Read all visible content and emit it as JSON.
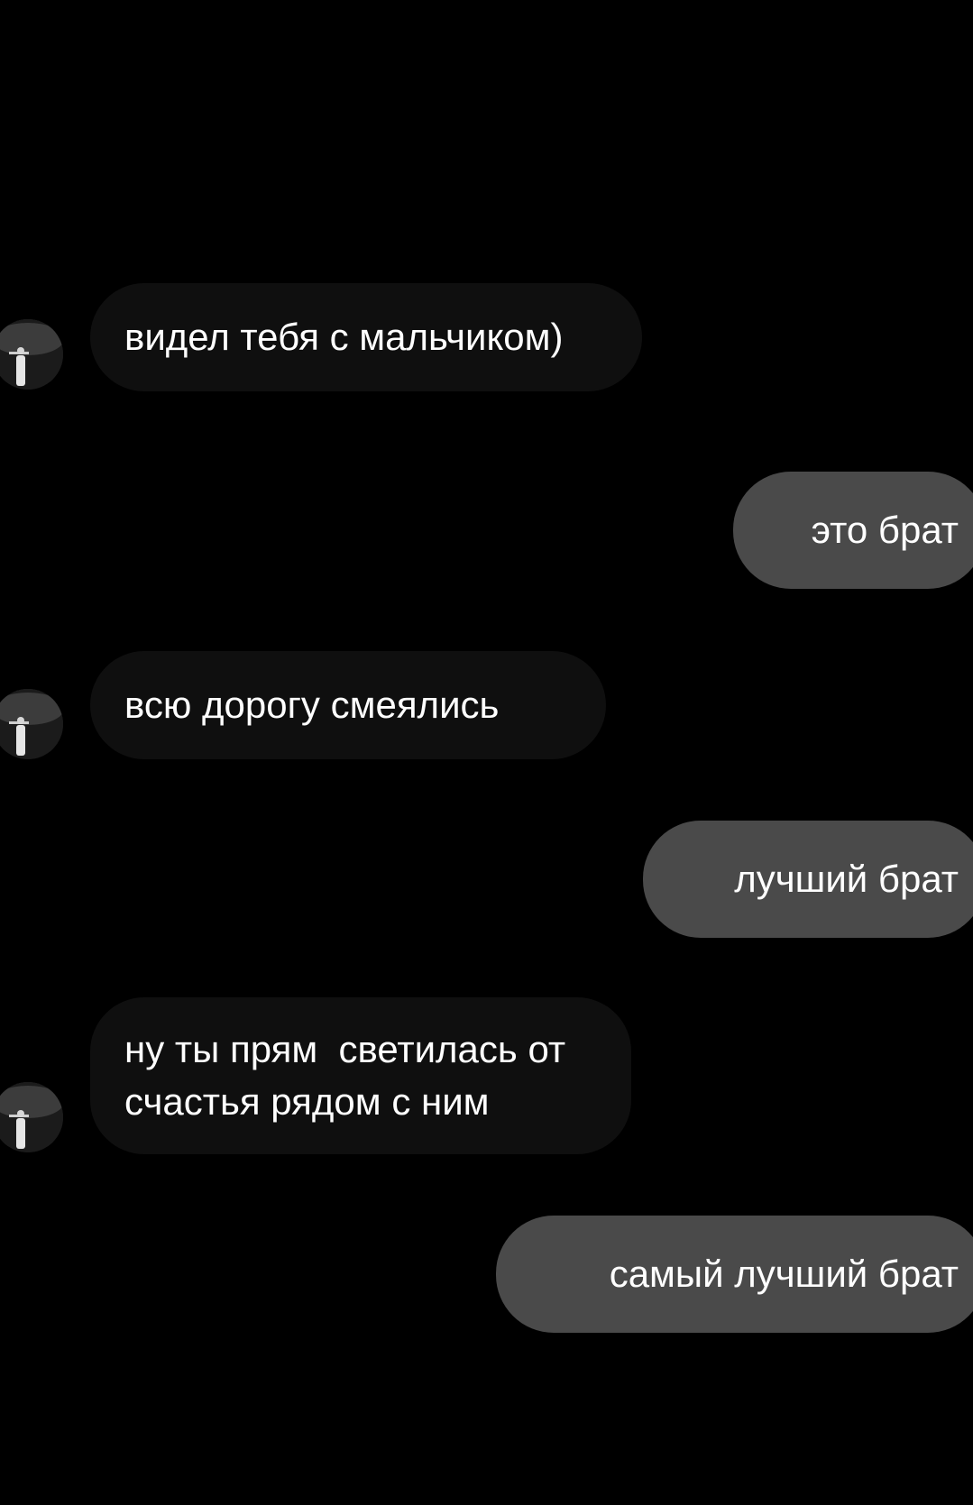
{
  "theme": {
    "background": "#000000",
    "incoming_bubble": "#0f0f0f",
    "outgoing_bubble": "#4a4a4a",
    "text": "#ffffff"
  },
  "contact": {
    "avatar_icon": "profile-photo-avatar"
  },
  "messages": [
    {
      "direction": "incoming",
      "text": "видел тебя с мальчиком)"
    },
    {
      "direction": "outgoing",
      "text": "это брат"
    },
    {
      "direction": "incoming",
      "text": "всю дорогу смеялись"
    },
    {
      "direction": "outgoing",
      "text": "лучший брат"
    },
    {
      "direction": "incoming",
      "text": "ну ты прям  светилась от\nсчастья рядом с ним"
    },
    {
      "direction": "outgoing",
      "text": "самый лучший брат"
    }
  ]
}
